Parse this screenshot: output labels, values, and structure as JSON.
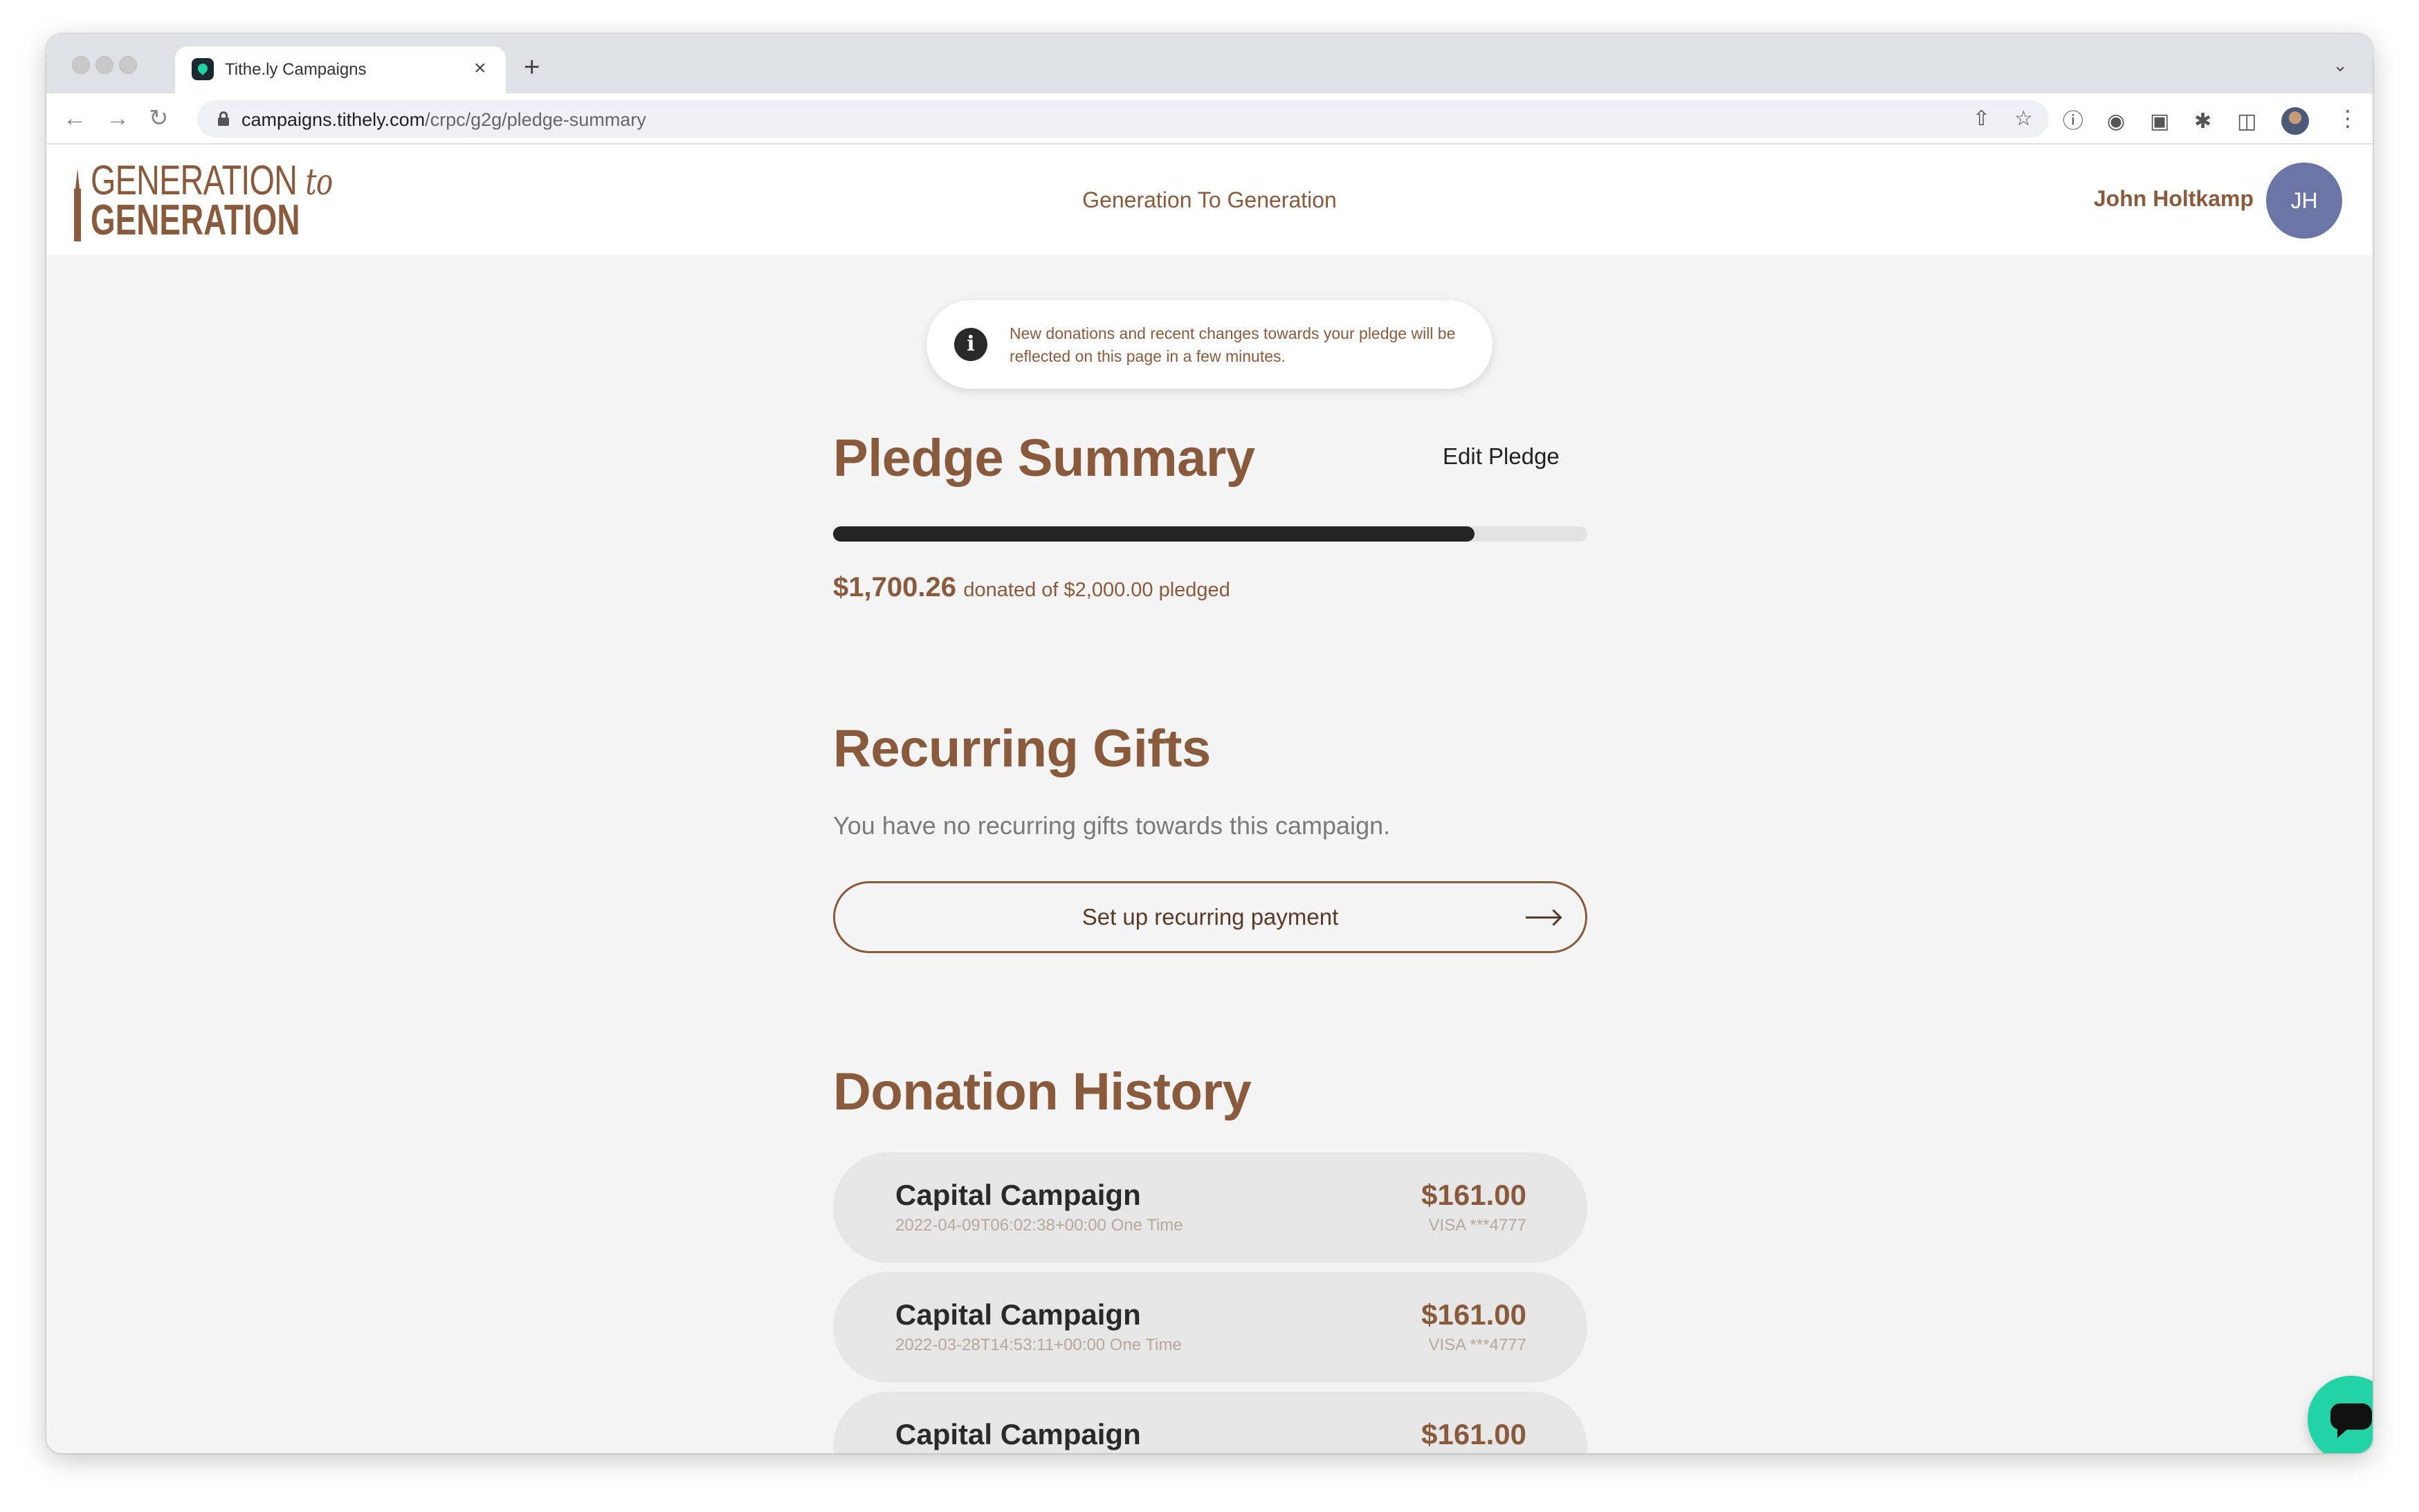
{
  "browser": {
    "tab_title": "Tithe.ly Campaigns",
    "tab_close": "×",
    "new_tab": "+",
    "url_host": "campaigns.tithely.com",
    "url_path": "/crpc/g2g/pledge-summary"
  },
  "header": {
    "logo_line1": "GENERATION",
    "logo_to": "to",
    "logo_line2": "GENERATION",
    "site_title": "Generation To Generation",
    "user_name": "John Holtkamp",
    "user_initials": "JH"
  },
  "notice": {
    "icon": "i",
    "text": "New donations and recent changes towards your pledge will be reflected on this page in a few minutes."
  },
  "pledge": {
    "heading": "Pledge Summary",
    "edit_label": "Edit Pledge",
    "donated_amount": "$1,700.26",
    "donated_label": "donated of $2,000.00 pledged",
    "progress_fraction": 0.8501
  },
  "recurring": {
    "heading": "Recurring Gifts",
    "empty_text": "You have no recurring gifts towards this campaign.",
    "button_label": "Set up recurring payment"
  },
  "history": {
    "heading": "Donation History",
    "items": [
      {
        "name": "Capital Campaign",
        "meta": "2022-04-09T06:02:38+00:00 One Time",
        "amount": "$161.00",
        "card": "VISA ***4777"
      },
      {
        "name": "Capital Campaign",
        "meta": "2022-03-28T14:53:11+00:00 One Time",
        "amount": "$161.00",
        "card": "VISA ***4777"
      },
      {
        "name": "Capital Campaign",
        "meta": "",
        "amount": "$161.00",
        "card": ""
      }
    ]
  },
  "colors": {
    "brand_brown": "#8a5a3c",
    "avatar_bg": "#6b76a6",
    "chat_green": "#22d3a6",
    "progress_fill": "#242424"
  }
}
